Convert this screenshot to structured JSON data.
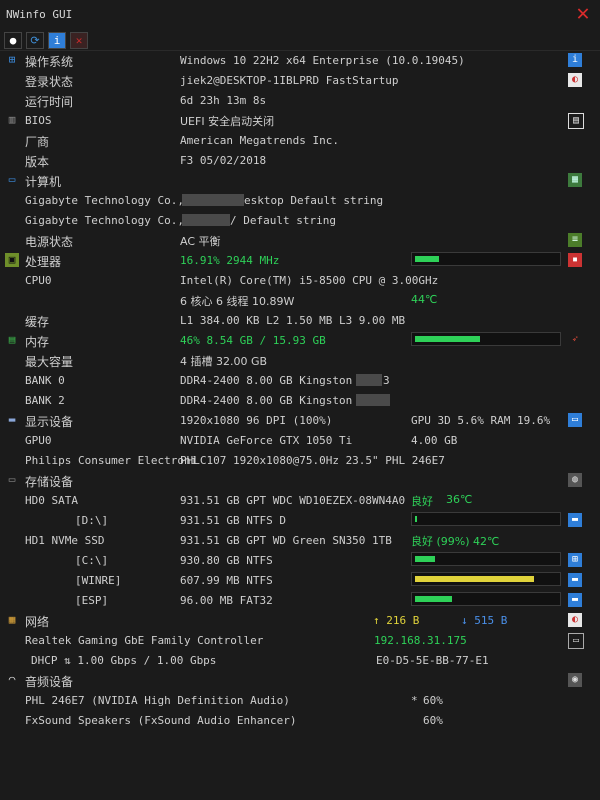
{
  "window": {
    "title": "NWinfo GUI",
    "close_glyph": "✕"
  },
  "toolbar": [
    {
      "name": "snapshot-icon",
      "glyph": "●",
      "color": "#ffffff"
    },
    {
      "name": "refresh-icon",
      "glyph": "⟳",
      "color": "#3f8fd8"
    },
    {
      "name": "info-icon",
      "glyph": "i",
      "color": "#ffffff"
    },
    {
      "name": "remove-icon",
      "glyph": "✕",
      "color": "#c82b2b"
    }
  ],
  "os": {
    "label": "操作系统",
    "value": "Windows 10 22H2 x64 Enterprise (10.0.19045)",
    "login_label": "登录状态",
    "login_value": "jiek2@DESKTOP-1IBLPRD FastStartup",
    "uptime_label": "运行时间",
    "uptime_value": "6d 23h 13m 8s",
    "bios_label": "BIOS",
    "bios_value": "UEFI 安全启动关闭",
    "vendor_label": "厂商",
    "vendor_value": "American Megatrends Inc.",
    "version_label": "版本",
    "version_value": "F3 05/02/2018"
  },
  "computer": {
    "label": "计算机",
    "row1_left": "Gigabyte Technology Co., L",
    "row1_right": "esktop Default string",
    "row2_left": "Gigabyte Technology Co., L",
    "row2_right": "/ Default string",
    "power_label": "电源状态",
    "power_value": "AC  平衡"
  },
  "cpu": {
    "label": "处理器",
    "usage": "16.91% 2944 MHz",
    "usage_fraction": 0.17,
    "cpu0_label": "CPU0",
    "cpu0_value": "Intel(R) Core(TM) i5-8500 CPU @ 3.00GHz",
    "cores": "6 核心 6 线程 10.89W",
    "temp": "44℃",
    "cache_label": "缓存",
    "cache_value": "L1 384.00 KB L2 1.50 MB L3 9.00 MB"
  },
  "memory": {
    "label": "内存",
    "usage": "46% 8.54 GB / 15.93 GB",
    "usage_fraction": 0.46,
    "max_label": "最大容量",
    "max_value": "4 插槽 32.00 GB",
    "bank0_label": "BANK 0",
    "bank0_value": "DDR4-2400 8.00 GB Kingston 1C",
    "bank0_tail": "3",
    "bank2_label": "BANK 2",
    "bank2_value": "DDR4-2400 8.00 GB Kingston 9C"
  },
  "display": {
    "label": "显示设备",
    "resolution": "1920x1080 96 DPI (100%)",
    "gpu_usage": "GPU 3D 5.6% RAM 19.6%",
    "gpu0_label": "GPU0",
    "gpu0_value": "NVIDIA GeForce GTX 1050 Ti",
    "gpu0_mem": "4.00 GB",
    "monitor_label": "Philips Consumer Electroni",
    "monitor_value": "PHLC107 1920x1080@75.0Hz 23.5\" PHL 246E7"
  },
  "storage": {
    "label": "存储设备",
    "hd0_label": "HD0 SATA",
    "hd0_value": "931.51 GB GPT WDC WD10EZEX-08WN4A0",
    "hd0_health": "良好",
    "hd0_temp": "36℃",
    "d_label": "[D:\\]",
    "d_value": "931.51 GB NTFS D",
    "d_fraction": 0.01,
    "hd1_label": "HD1 NVMe SSD",
    "hd1_value": "931.51 GB GPT WD Green SN350 1TB",
    "hd1_health": "良好 (99%) 42℃",
    "c_label": "[C:\\]",
    "c_value": "930.80 GB NTFS",
    "c_fraction": 0.14,
    "winre_label": "[WINRE]",
    "winre_value": "607.99 MB NTFS",
    "winre_fraction": 0.84,
    "esp_label": "[ESP]",
    "esp_value": "96.00 MB FAT32",
    "esp_fraction": 0.26
  },
  "network": {
    "label": "网络",
    "up": "↑ 216 B",
    "down": "↓ 515 B",
    "adapter": "Realtek Gaming GbE Family Controller",
    "ip": "192.168.31.175",
    "dhcp": "DHCP ⇅ 1.00 Gbps / 1.00 Gbps",
    "mac": "E0-D5-5E-BB-77-E1"
  },
  "audio": {
    "label": "音频设备",
    "dev1": "PHL 246E7 (NVIDIA High Definition Audio)",
    "dev1_mark": "*",
    "dev1_vol": "60%",
    "dev2": "FxSound Speakers (FxSound Audio Enhancer)",
    "dev2_vol": "60%"
  },
  "colors": {
    "accent_green": "#2ed158",
    "bar_yellow": "#e0d33b",
    "bar_blue": "#2f7ed8",
    "close_red": "#d92b2b"
  }
}
